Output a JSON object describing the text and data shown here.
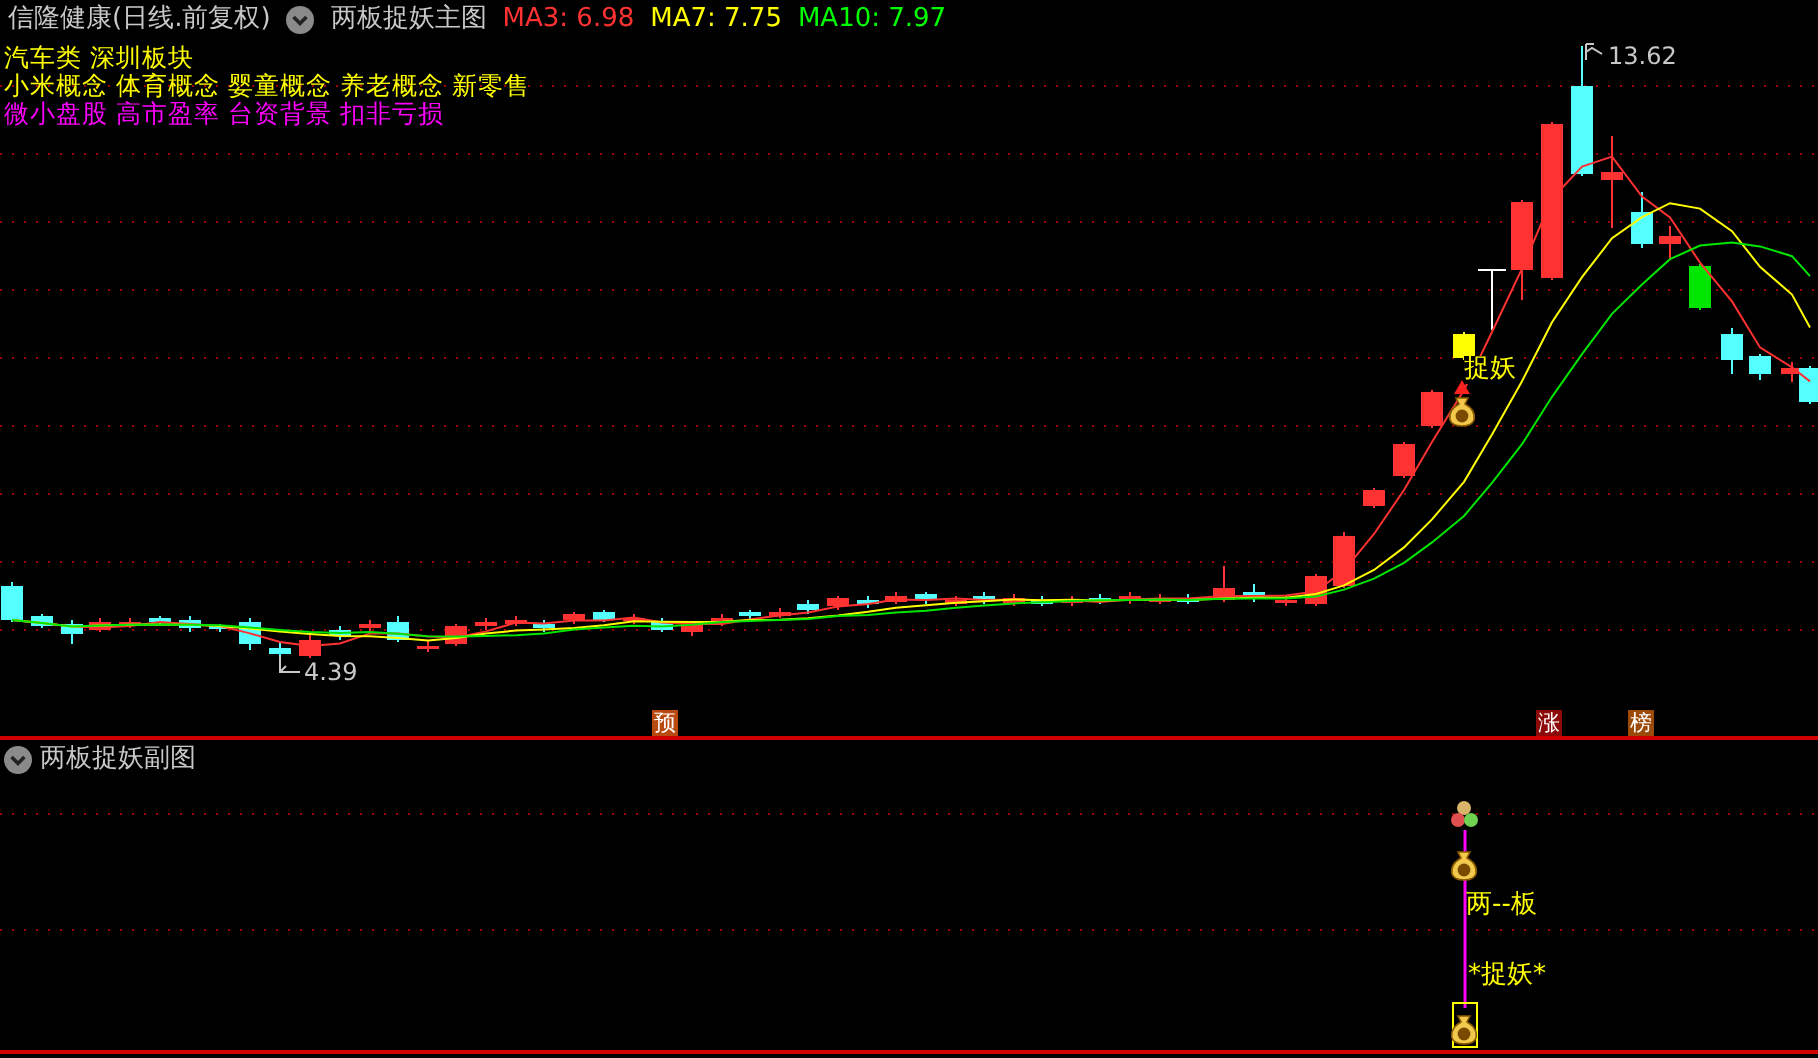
{
  "header": {
    "stock_title": "信隆健康(日线.前复权)",
    "indicator": "两板捉妖主图",
    "moving_averages": [
      {
        "label": "MA3: 6.98",
        "color": "#ff3232"
      },
      {
        "label": "MA7: 7.75",
        "color": "#ffff00"
      },
      {
        "label": "MA10: 7.97",
        "color": "#00ff00"
      }
    ]
  },
  "tag_rows": [
    [
      {
        "text": "汽车类",
        "color": "#ffff00"
      },
      {
        "text": "深圳板块",
        "color": "#ffff00"
      }
    ],
    [
      {
        "text": "小米概念",
        "color": "#ffff00"
      },
      {
        "text": "体育概念",
        "color": "#ffff00"
      },
      {
        "text": "婴童概念",
        "color": "#ffff00"
      },
      {
        "text": "养老概念",
        "color": "#ffff00"
      },
      {
        "text": "新零售",
        "color": "#ffff00"
      }
    ],
    [
      {
        "text": "微小盘股",
        "color": "#ff00ff"
      },
      {
        "text": "高市盈率",
        "color": "#ff00ff"
      },
      {
        "text": "台资背景",
        "color": "#ff00ff"
      },
      {
        "text": "扣非亏损",
        "color": "#ff00ff"
      }
    ]
  ],
  "main_chart": {
    "high_label": "13.62",
    "low_label": "4.39",
    "signal_label": "捉妖",
    "markers": [
      {
        "text": "预",
        "color": "#b84a10"
      },
      {
        "text": "涨",
        "color": "#8c0a0a"
      },
      {
        "text": "榜",
        "color": "#9c4a08"
      }
    ]
  },
  "sub_chart": {
    "title": "两板捉妖副图",
    "label_1": "两--板",
    "label_2": "*捉妖*"
  }
}
